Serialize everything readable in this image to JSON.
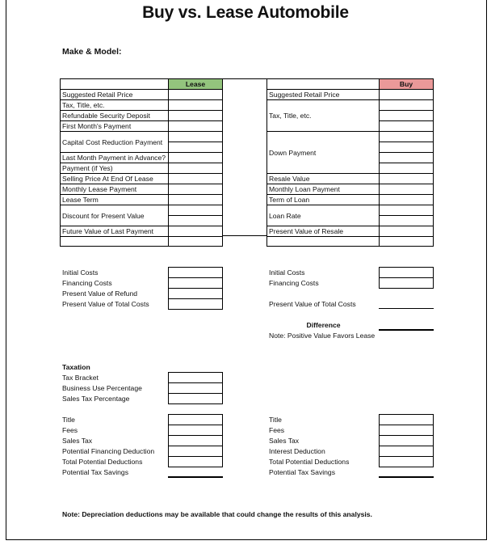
{
  "title": "Buy vs. Lease Automobile",
  "make_model_label": "Make & Model:",
  "colors": {
    "lease_header": "#93c47d",
    "buy_header": "#ea9999"
  },
  "lease_table": {
    "header": "Lease",
    "rows": [
      {
        "label": "Suggested Retail Price"
      },
      {
        "label": "Tax, Title, etc."
      },
      {
        "label": "Refundable Security Deposit"
      },
      {
        "label": "First Month's Payment"
      },
      {
        "label": "Capital Cost Reduction Payment"
      },
      {
        "label": "Last Month Payment in Advance?"
      },
      {
        "label": "Payment (if Yes)"
      },
      {
        "label": "Selling Price At End Of Lease"
      },
      {
        "label": "Monthly Lease Payment"
      },
      {
        "label": "Lease Term"
      },
      {
        "label": "Discount for Present Value"
      },
      {
        "label": "Future Value of Last Payment"
      },
      {
        "label": ""
      }
    ]
  },
  "buy_table": {
    "header": "Buy",
    "rows": [
      {
        "label": "Suggested Retail Price"
      },
      {
        "label": "Tax, Title, etc."
      },
      {
        "label": "Down Payment"
      },
      {
        "label": "Resale Value"
      },
      {
        "label": "Monthly Loan Payment"
      },
      {
        "label": "Term of Loan"
      },
      {
        "label": "Loan Rate"
      },
      {
        "label": "Present Value of Resale"
      },
      {
        "label": ""
      }
    ]
  },
  "lease_summary": [
    "Initial Costs",
    "Financing Costs",
    "Present Value of Refund",
    "Present Value of Total Costs"
  ],
  "buy_summary": [
    "Initial Costs",
    "Financing Costs",
    "Present Value of Total Costs"
  ],
  "difference": {
    "label": "Difference",
    "note": "Note: Positive Value Favors Lease"
  },
  "taxation": {
    "heading": "Taxation",
    "inputs": [
      "Tax Bracket",
      "Business Use Percentage",
      "Sales Tax Percentage"
    ],
    "lease_items": [
      "Title",
      "Fees",
      "Sales Tax",
      "Potential Financing Deduction",
      "Total Potential Deductions",
      "Potential Tax Savings"
    ],
    "buy_items": [
      "Title",
      "Fees",
      "Sales Tax",
      "Interest Deduction",
      "Total Potential Deductions",
      "Potential Tax Savings"
    ]
  },
  "footer_note": "Note: Depreciation deductions may be available that could change the results of this analysis."
}
